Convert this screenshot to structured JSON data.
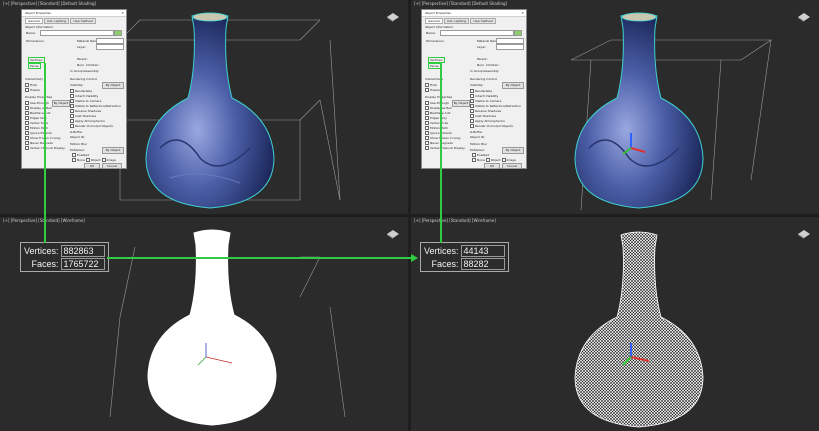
{
  "viewports": {
    "top_left": {
      "label": "[+] [Perspective] [Standard] [Default Shading]"
    },
    "top_right": {
      "label": "[+] [Perspective] [Standard] [Default Shading]"
    },
    "bottom_left": {
      "label": "[+] [Perspective] [Standard] [Wireframe]"
    },
    "bottom_right": {
      "label": "[+] [Perspective] [Standard] [Wireframe]"
    }
  },
  "dialog": {
    "title": "Object Properties",
    "close": "✕",
    "tabs": [
      "General",
      "Adv. Lighting",
      "User Defined"
    ],
    "sections": {
      "object_info": "Object Information",
      "interactivity": "Interactivity",
      "display_props": "Display Properties",
      "rendering": "Rendering Control",
      "motion_blur": "Motion Blur"
    },
    "fields": {
      "name_label": "Name:",
      "dimensions_label": "Dimensions:",
      "vertices_label": "Vertices:",
      "faces_label": "Faces:",
      "material_name_label": "Material Name:",
      "layer_label": "Layer:",
      "parent_label": "Parent:",
      "num_children_label": "Num. Children:",
      "in_group_label": "In Group/Assembly:"
    },
    "checkboxes_left": [
      "Hide",
      "Freeze",
      "See-Through",
      "Display as Box",
      "Backface Cull",
      "Edges Only",
      "Vertex Ticks",
      "Motion Path",
      "Ignore Extents",
      "Show Frozen in Gray",
      "Never Degrade",
      "Vertex Channel Display"
    ],
    "checkboxes_right": [
      "Renderable",
      "Inherit Visibility",
      "Visible to Camera",
      "Visible to Reflection/Refraction",
      "Receive Shadows",
      "Cast Shadows",
      "Apply Atmospherics",
      "Render Occluded Objects"
    ],
    "by_object": "By Object",
    "visibility_label": "Visibility:",
    "g_buffer": "G-Buffer",
    "object_id": "Object ID:",
    "multiplier": "Multiplier:",
    "enabled": "Enabled",
    "radio": [
      "None",
      "Object",
      "Image"
    ],
    "ok": "OK",
    "cancel": "Cancel"
  },
  "stats_left": {
    "vertices_label": "Vertices:",
    "vertices": "882863",
    "faces_label": "Faces:",
    "faces": "1765722"
  },
  "stats_right": {
    "vertices_label": "Vertices:",
    "vertices": "44143",
    "faces_label": "Faces:",
    "faces": "88282"
  },
  "colors": {
    "accent_green": "#2ecc40",
    "viewport_bg": "#2b2b2b",
    "active_border": "#c8b850",
    "vase_blue": "#4b5fa8"
  }
}
